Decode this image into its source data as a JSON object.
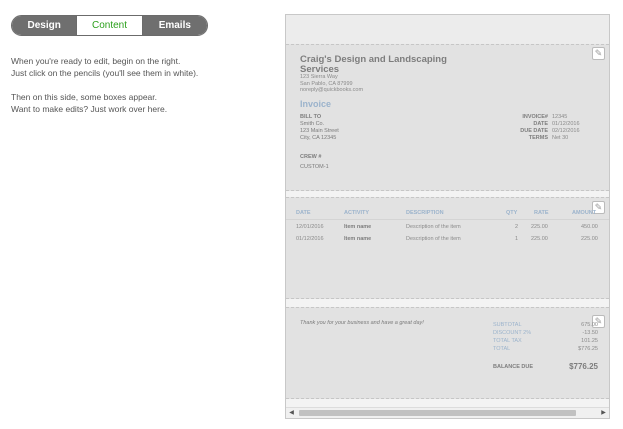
{
  "tabs": [
    {
      "label": "Design",
      "active": false
    },
    {
      "label": "Content",
      "active": true
    },
    {
      "label": "Emails",
      "active": false
    }
  ],
  "intro": {
    "line1": "When you're ready to edit, begin on the right.",
    "line2": "Just click on the pencils (you'll see them in white).",
    "line3": "Then on this side, some boxes appear.",
    "line4": "Want to make edits? Just work over here."
  },
  "invoice": {
    "company": "Craig's Design and Landscaping Services",
    "address": [
      "123 Sierra Way",
      "San Pablo, CA 87999",
      "noreply@quickbooks.com"
    ],
    "title": "Invoice",
    "bill_to_label": "BILL TO",
    "bill_to": [
      "Smith Co.",
      "123 Main Street",
      "City, CA 12345"
    ],
    "meta": [
      {
        "k": "INVOICE#",
        "v": "12345"
      },
      {
        "k": "DATE",
        "v": "01/12/2016"
      },
      {
        "k": "DUE DATE",
        "v": "02/12/2016"
      },
      {
        "k": "TERMS",
        "v": "Net 30"
      }
    ],
    "crew_label": "CREW #",
    "custom": "CUSTOM-1",
    "columns": [
      "DATE",
      "ACTIVITY",
      "DESCRIPTION",
      "QTY",
      "RATE",
      "AMOUNT"
    ],
    "rows": [
      [
        "12/01/2016",
        "Item name",
        "Description of the item",
        "2",
        "225.00",
        "450.00"
      ],
      [
        "01/12/2016",
        "Item name",
        "Description of the item",
        "1",
        "225.00",
        "225.00"
      ]
    ],
    "thanks": "Thank you for your business and have a great day!",
    "totals": [
      {
        "k": "SUBTOTAL",
        "v": "675.00"
      },
      {
        "k": "DISCOUNT 2%",
        "v": "-13.50"
      },
      {
        "k": "TOTAL TAX",
        "v": "101.25"
      },
      {
        "k": "TOTAL",
        "v": "$776.25"
      }
    ],
    "balance_label": "BALANCE DUE",
    "balance_value": "$776.25"
  },
  "icons": {
    "pencil": "pencil-icon",
    "scroll_left": "arrow-left-icon",
    "scroll_right": "arrow-right-icon"
  },
  "colors": {
    "accent": "#2ca01c",
    "tab_bg": "#6f6f6f",
    "invoice_blue": "#9bb3cc"
  }
}
